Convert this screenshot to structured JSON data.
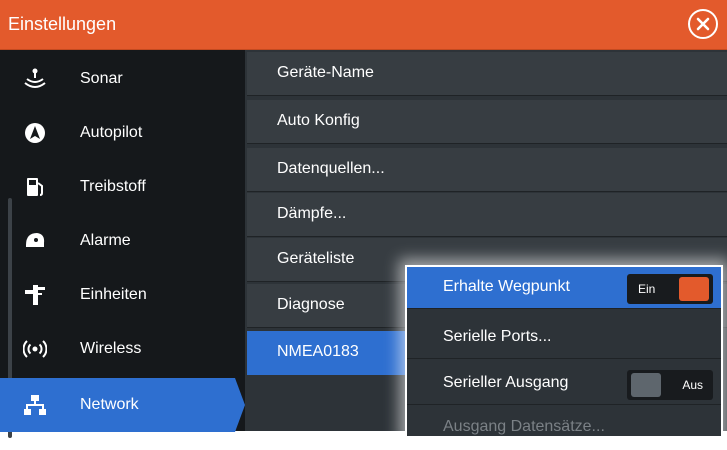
{
  "window": {
    "title": "Einstellungen",
    "close_icon": "close-circle-icon",
    "accent_color": "#e35a2c",
    "selection_color": "#2e6fd0"
  },
  "sidebar": {
    "items": [
      {
        "label": "Sonar",
        "icon": "sonar-icon"
      },
      {
        "label": "Autopilot",
        "icon": "autopilot-icon"
      },
      {
        "label": "Treibstoff",
        "icon": "fuel-icon"
      },
      {
        "label": "Alarme",
        "icon": "alarm-icon"
      },
      {
        "label": "Einheiten",
        "icon": "units-icon"
      },
      {
        "label": "Wireless",
        "icon": "wireless-icon"
      },
      {
        "label": "Network",
        "icon": "network-icon"
      }
    ],
    "selected": "Network"
  },
  "network_menu": {
    "items": [
      {
        "label": "Geräte-Name"
      },
      {
        "label": "Auto Konfig"
      },
      {
        "label": "Datenquellen..."
      },
      {
        "label": "Dämpfe..."
      },
      {
        "label": "Geräteliste"
      },
      {
        "label": "Diagnose"
      },
      {
        "label": "NMEA0183"
      }
    ],
    "selected": "NMEA0183"
  },
  "nmea_popup": {
    "items": [
      {
        "label": "Erhalte Wegpunkt",
        "toggle": "Ein",
        "state": "on"
      },
      {
        "label": "Serielle Ports..."
      },
      {
        "label": "Serieller Ausgang",
        "toggle": "Aus",
        "state": "off"
      },
      {
        "label": "Ausgang Datensätze...",
        "enabled": false
      }
    ]
  }
}
